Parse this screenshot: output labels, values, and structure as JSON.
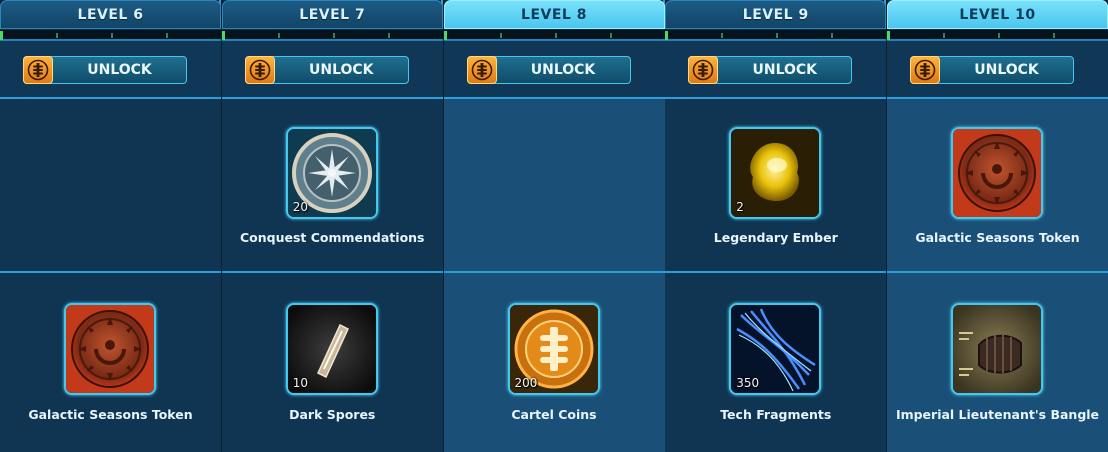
{
  "unlock_label": "UNLOCK",
  "levels": [
    {
      "label": "LEVEL 6",
      "highlighted": false,
      "top_reward": null,
      "bottom_reward": {
        "name": "Galactic Seasons Token",
        "quantity": "",
        "icon": "seasons-token-icon"
      }
    },
    {
      "label": "LEVEL 7",
      "highlighted": false,
      "top_reward": {
        "name": "Conquest Commendations",
        "quantity": "20",
        "icon": "conquest-commendation-icon"
      },
      "bottom_reward": {
        "name": "Dark Spores",
        "quantity": "10",
        "icon": "dark-spore-icon"
      }
    },
    {
      "label": "LEVEL 8",
      "highlighted": true,
      "top_reward": null,
      "bottom_reward": {
        "name": "Cartel Coins",
        "quantity": "200",
        "icon": "cartel-coin-icon"
      }
    },
    {
      "label": "LEVEL 9",
      "highlighted": false,
      "top_reward": {
        "name": "Legendary Ember",
        "quantity": "2",
        "icon": "legendary-ember-icon"
      },
      "bottom_reward": {
        "name": "Tech Fragments",
        "quantity": "350",
        "icon": "tech-fragments-icon"
      }
    },
    {
      "label": "LEVEL 10",
      "highlighted": true,
      "top_reward": {
        "name": "Galactic Seasons Token",
        "quantity": "",
        "icon": "seasons-token-icon"
      },
      "bottom_reward": {
        "name": "Imperial Lieutenant's Bangle",
        "quantity": "",
        "icon": "bangle-icon"
      }
    }
  ],
  "colors": {
    "header": "#1d5c85",
    "header_highlight": "#5fd0f5",
    "accent_border": "#2b9fdc",
    "unlock_icon": "#f39a22"
  }
}
